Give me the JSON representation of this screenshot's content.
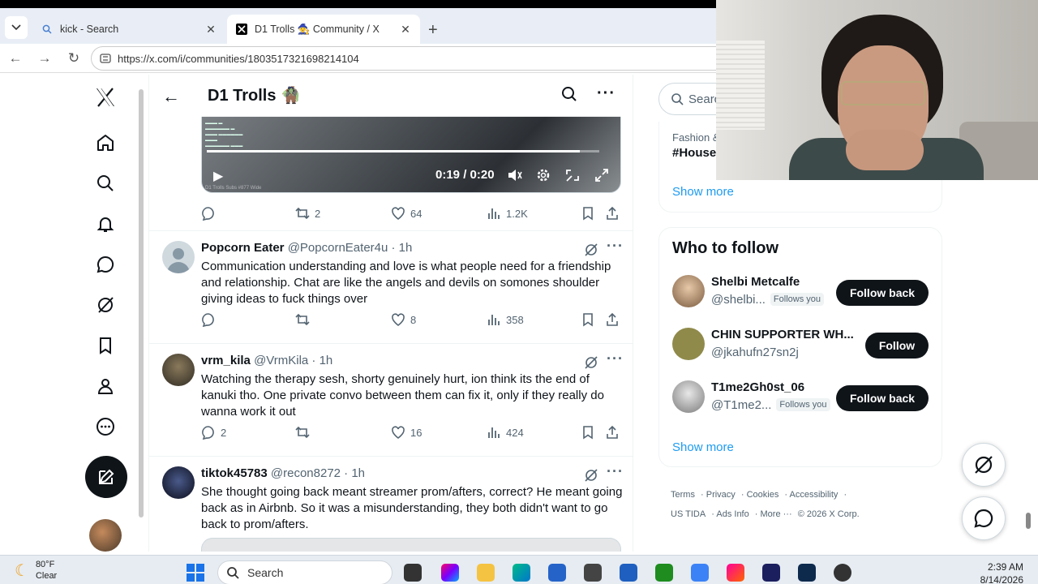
{
  "browser": {
    "tabs": [
      {
        "title": "kick - Search",
        "active": false
      },
      {
        "title": "D1 Trolls 🧙 Community / X",
        "active": true
      }
    ],
    "url": "https://x.com/i/communities/1803517321698214104"
  },
  "community": {
    "title": "D1 Trolls 🧌"
  },
  "video": {
    "time": "0:19 / 0:20",
    "progress": 0.95,
    "watermark": "D1 Trolls Subs #877 Wide"
  },
  "first_post_actions": {
    "replies": "",
    "reposts": "2",
    "likes": "64",
    "views": "1.2K"
  },
  "posts": [
    {
      "name": "Popcorn Eater",
      "handle": "@PopcornEater4u · 1h",
      "text": "Communication understanding and love is what people need for a friendship and relationship. Chat are like the angels and devils on somones shoulder giving ideas to fuck things over",
      "replies": "",
      "reposts": "",
      "likes": "8",
      "views": "358"
    },
    {
      "name": "vrm_kila",
      "handle": "@VrmKila · 1h",
      "text": "Watching the therapy sesh, shorty genuinely hurt, ion think its the end of kanuki tho. One private convo between them can fix it, only if they really do wanna work it out",
      "replies": "2",
      "reposts": "",
      "likes": "16",
      "views": "424"
    },
    {
      "name": "tiktok45783",
      "handle": "@recon8272 · 1h",
      "text": "She thought going back meant streamer prom/afters, correct? He meant going back as in Airbnb. So it was a misunderstanding, they both didn't want to go back to prom/afters."
    }
  ],
  "sidebar": {
    "search_placeholder": "Search",
    "trend_category": "Fashion &",
    "trend_tag": "#House",
    "show_more": "Show more",
    "who_to_follow_title": "Who to follow",
    "follows_you": "Follows you",
    "suggestions": [
      {
        "name": "Shelbi Metcalfe",
        "handle": "@shelbi...",
        "follows_you": true,
        "button": "Follow back"
      },
      {
        "name": "CHIN SUPPORTER WH...",
        "handle": "@jkahufn27sn2j",
        "follows_you": false,
        "button": "Follow"
      },
      {
        "name": "T1me2Gh0st_06",
        "handle": "@T1me2...",
        "follows_you": true,
        "button": "Follow back"
      }
    ],
    "show_more_2": "Show more",
    "footer": {
      "terms": "Terms",
      "privacy": "Privacy",
      "cookies": "Cookies",
      "accessibility": "Accessibility",
      "ustida": "US TIDA",
      "ads_info": "Ads Info",
      "more": "More ···",
      "copyright": "© 2026 X Corp."
    }
  },
  "taskbar": {
    "temp": "80°F",
    "condition": "Clear",
    "search": "Search",
    "time": "2:39 AM",
    "date": "8/14/2026"
  },
  "colors": {
    "accent": "#1d9bf0",
    "text": "#0f1419",
    "muted": "#536471",
    "follow_bg": "#0f1419"
  }
}
